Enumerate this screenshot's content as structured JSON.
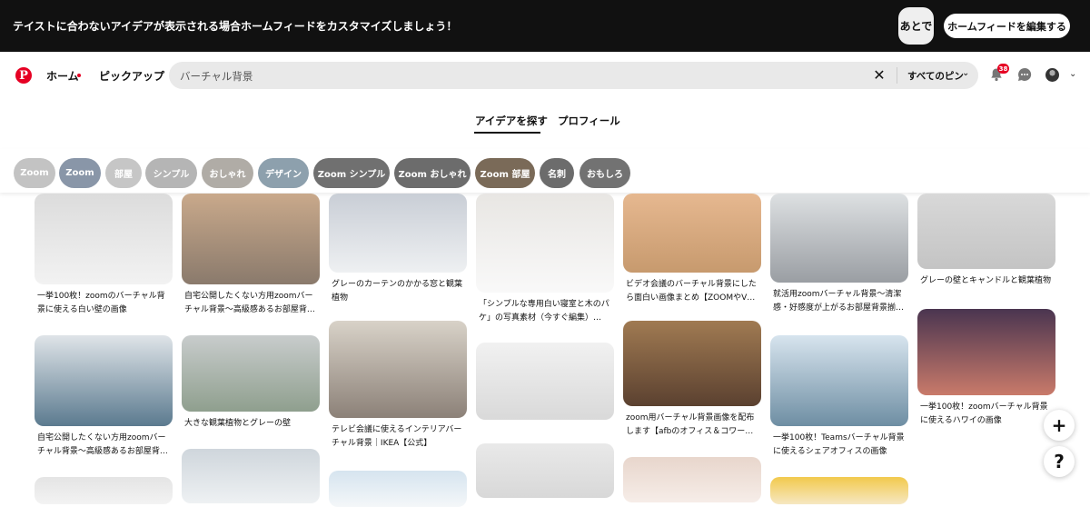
{
  "banner": {
    "message": "テイストに合わないアイデアが表示される場合ホームフィードをカスタマイズしましょう！",
    "later_label": "あとで",
    "edit_feed_label": "ホームフィードを編集する"
  },
  "nav": {
    "home_label": "ホーム",
    "pickup_label": "ピックアップ",
    "logo_glyph": "P"
  },
  "search": {
    "value": "バーチャル背景",
    "filter_label": "すべてのピン"
  },
  "notifications": {
    "count": "38"
  },
  "tabs": [
    {
      "label": "アイデアを探す",
      "active": true
    },
    {
      "label": "プロフィール",
      "active": false
    }
  ],
  "pills": [
    {
      "label": "Zoom",
      "color": "#c3c3c3"
    },
    {
      "label": "Zoom",
      "color": "#8996a8"
    },
    {
      "label": "部屋",
      "color": "#c6c6c6"
    },
    {
      "label": "シンプル",
      "color": "#b5b5b5"
    },
    {
      "label": "おしゃれ",
      "color": "#b0aca6"
    },
    {
      "label": "デザイン",
      "color": "#8da0ad"
    },
    {
      "label": "Zoom シンプル",
      "color": "#707070"
    },
    {
      "label": "Zoom おしゃれ",
      "color": "#6c6c6c"
    },
    {
      "label": "Zoom 部屋",
      "color": "#7a6a58"
    },
    {
      "label": "名刺",
      "color": "#6c6c6c"
    },
    {
      "label": "おもしろ",
      "color": "#727272"
    }
  ],
  "pins": [
    {
      "title": "一挙100枚！zoomのバーチャル背景に使える白い壁の画像",
      "colors": [
        "#dcdcdc",
        "#f2f2f2"
      ]
    },
    {
      "title": "自宅公開したくない方用zoomバーチャル背景〜高級感あるお部屋背…",
      "colors": [
        "#c9a98b",
        "#8a7a6c"
      ]
    },
    {
      "title": "グレーのカーテンのかかる窓と観葉植物",
      "colors": [
        "#c9ced6",
        "#eef0f2"
      ]
    },
    {
      "title": "「シンプルな専用白い寝室と木のパケ」の写真素材（今すぐ編集）…",
      "colors": [
        "#e8e6e3",
        "#f9f9f9"
      ]
    },
    {
      "title": "ビデオ会議のバーチャル背景にしたら面白い画像まとめ【ZOOMやV…",
      "colors": [
        "#e6b890",
        "#c79a6e"
      ]
    },
    {
      "title": "就活用zoomバーチャル背景〜清潔感・好感度が上がるお部屋背景揃…",
      "colors": [
        "#dde0e2",
        "#9a9ea3"
      ]
    },
    {
      "title": "グレーの壁とキャンドルと観葉植物",
      "colors": [
        "#d8d8d8",
        "#c4c4c4"
      ]
    },
    {
      "title": "自宅公開したくない方用zoomバーチャル背景〜高級感あるお部屋背…",
      "colors": [
        "#dfe4e8",
        "#5b7a8f"
      ]
    },
    {
      "title": "大きな観葉植物とグレーの壁",
      "colors": [
        "#c8cccc",
        "#8f9f8e"
      ]
    },
    {
      "title": "テレビ会議に使えるインテリアバーチャル背景｜IKEA【公式】",
      "colors": [
        "#d8d2c8",
        "#8c8178"
      ]
    },
    {
      "title": "",
      "colors": [
        "#f1f1f1",
        "#d9d9d9"
      ]
    },
    {
      "title": "zoom用バーチャル背景画像を配布します【afbのオフィス＆コワー…",
      "colors": [
        "#a07a52",
        "#5b4130"
      ]
    },
    {
      "title": "一挙100枚！Teamsバーチャル背景に使えるシェアオフィスの画像",
      "colors": [
        "#d7e4ee",
        "#6e8ea3"
      ]
    },
    {
      "title": "一挙100枚！zoomバーチャル背景に使えるハワイの画像",
      "colors": [
        "#4a3550",
        "#c97a6a"
      ]
    },
    {
      "title": "",
      "colors": [
        "#e4e4e4",
        "#f3f3f3"
      ]
    },
    {
      "title": "",
      "colors": [
        "#cfd6dc",
        "#eef1f3"
      ]
    },
    {
      "title": "",
      "colors": [
        "#d6e4ef",
        "#f4f7f9"
      ]
    },
    {
      "title": "",
      "colors": [
        "#e9e9e9",
        "#d8d8d8"
      ]
    },
    {
      "title": "",
      "colors": [
        "#e8d6cc",
        "#f6ede8"
      ]
    },
    {
      "title": "",
      "colors": [
        "#f2c94c",
        "#f6e7c2"
      ]
    }
  ],
  "fabs": {
    "add_glyph": "+",
    "help_glyph": "?"
  }
}
